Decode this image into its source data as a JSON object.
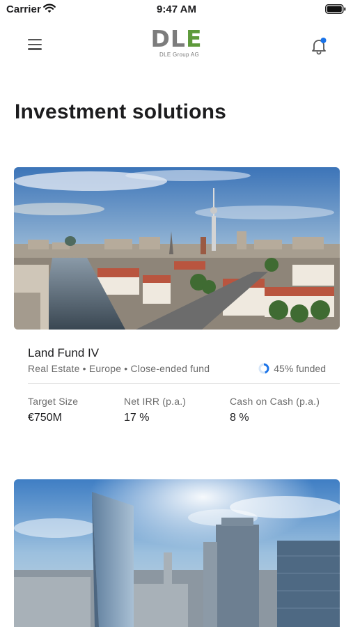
{
  "status_bar": {
    "carrier": "Carrier",
    "time": "9:47 AM"
  },
  "header": {
    "logo_text_dl": "DL",
    "logo_text_e": "E",
    "logo_subtitle": "DLE Group AG",
    "notification_dot_color": "#1a73e8"
  },
  "page": {
    "title": "Investment solutions"
  },
  "funds": [
    {
      "name": "Land Fund IV",
      "tags": "Real Estate • Europe • Close-ended fund",
      "funded_label": "45% funded",
      "funded_fraction": 0.45,
      "metrics": [
        {
          "label": "Target Size",
          "value": "€750M"
        },
        {
          "label": "Net IRR (p.a.)",
          "value": "17 %"
        },
        {
          "label": "Cash on Cash (p.a.)",
          "value": "8 %"
        }
      ]
    }
  ],
  "colors": {
    "accent_green": "#5e9a3b",
    "progress_blue": "#1a73e8",
    "text_secondary": "#6b6b6b"
  }
}
